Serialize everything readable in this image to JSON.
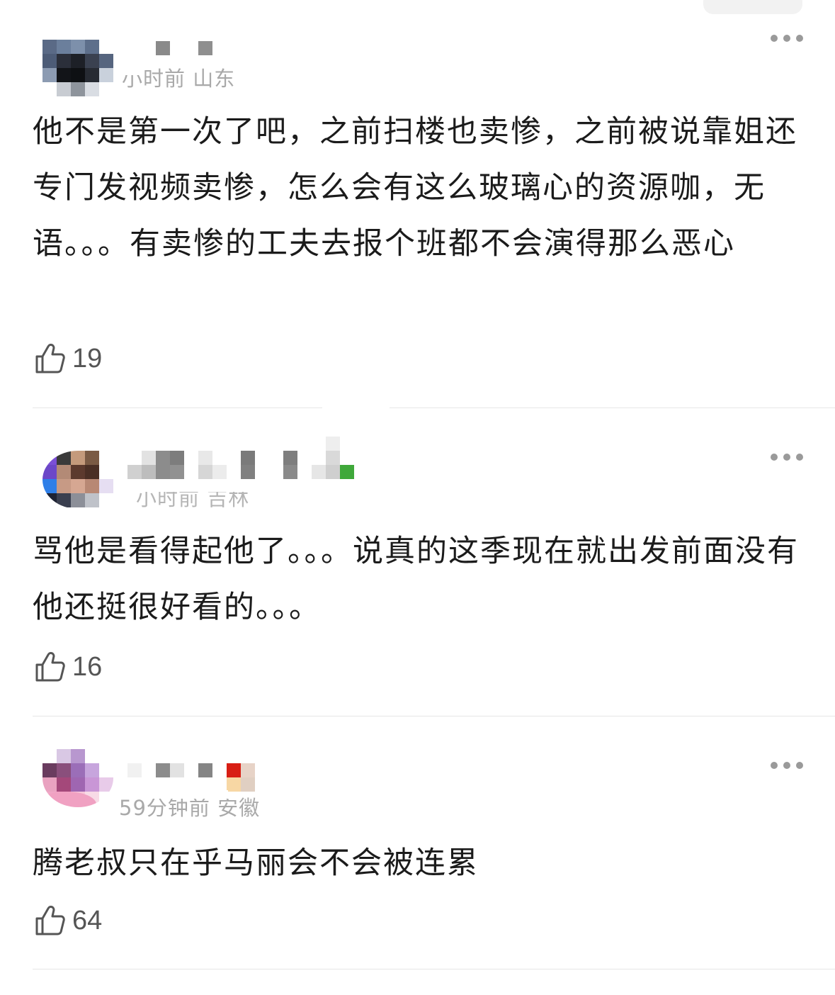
{
  "comments": [
    {
      "meta": "小时前 山东",
      "text": "他不是第一次了吧，之前扫楼也卖惨，之前被说靠姐还专门发视频卖惨，怎么会有这么玻璃心的资源咖，无语。。。有卖惨的工夫去报个班都不会演得那么恶心",
      "likes": "19",
      "like_icon": "thumbs-up-icon",
      "more_icon": "more-dots-icon"
    },
    {
      "meta": "小时前 吉林",
      "text": "骂他是看得起他了。。。说真的这季现在就出发前面没有他还挺很好看的。。。",
      "likes": "16",
      "like_icon": "thumbs-up-icon",
      "more_icon": "more-dots-icon"
    },
    {
      "meta": "59分钟前 安徽",
      "text": "腾老叔只在乎马丽会不会被连累",
      "likes": "64",
      "like_icon": "thumbs-up-icon",
      "more_icon": "more-dots-icon"
    }
  ],
  "colors": {
    "background": "#ffffff",
    "text": "#1b1b1b",
    "meta": "#a9a9a9",
    "icon": "#555555",
    "divider": "#e6e6e6"
  }
}
